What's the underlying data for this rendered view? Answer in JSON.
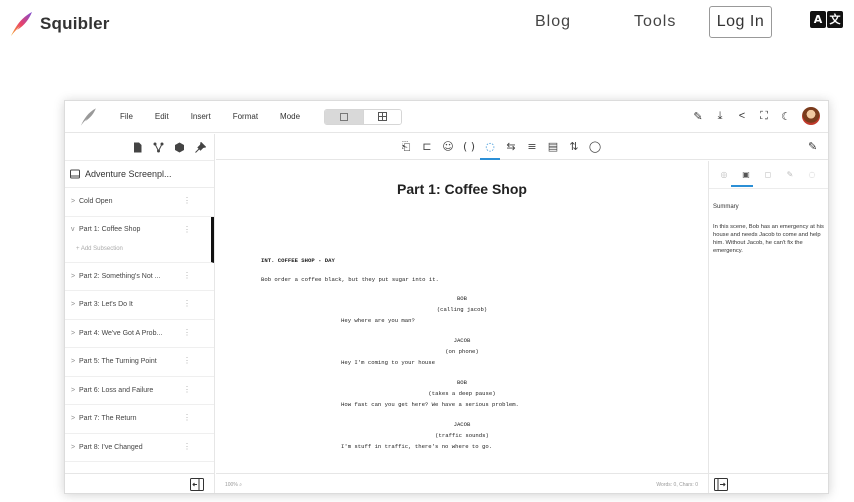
{
  "site": {
    "brand": "Squibler",
    "nav": {
      "blog": "Blog",
      "tools": "Tools",
      "login": "Log In"
    },
    "language_glyphs": [
      "A",
      "文"
    ]
  },
  "app": {
    "menu": [
      "File",
      "Edit",
      "Insert",
      "Format",
      "Mode"
    ],
    "document_title": "Adventure Screenpl...",
    "chapters": [
      {
        "label": "Cold Open",
        "chevron": ">"
      },
      {
        "label": "Part 1: Coffee Shop",
        "chevron": "v",
        "active": true,
        "sub": "+ Add Subsection"
      },
      {
        "label": "Part 2: Something's Not ...",
        "chevron": ">"
      },
      {
        "label": "Part 3: Let's Do It",
        "chevron": ">"
      },
      {
        "label": "Part 4: We've Got A Prob...",
        "chevron": ">"
      },
      {
        "label": "Part 5: The Turning Point",
        "chevron": ">"
      },
      {
        "label": "Part 6: Loss and Failure",
        "chevron": ">"
      },
      {
        "label": "Part 7: The Return",
        "chevron": ">"
      },
      {
        "label": "Part 8: I've Changed",
        "chevron": ">"
      }
    ],
    "scene_title": "Part 1: Coffee Shop",
    "script": {
      "slugline": "INT. COFFEE SHOP - DAY",
      "action": "Bob order a coffee black, but they put sugar into it.",
      "block1_character": "BOB",
      "block1_paren": "(calling jacob)",
      "block1_dialogue": "Hey where are you man?",
      "block2_character": "JACOB",
      "block2_paren": "(on phone)",
      "block2_dialogue": "Hey I'm coming to your house",
      "block3_character": "BOB",
      "block3_paren": "(takes a deep pause)",
      "block3_dialogue": "How fast can you get here? We have a serious problem.",
      "block4_character": "JACOB",
      "block4_paren": "(traffic sounds)",
      "block4_dialogue": "I'm stuff in traffic, there's no where to go."
    },
    "status": {
      "zoom": "100%",
      "counts": "Words: 0, Chars: 0"
    },
    "right_panel": {
      "summary_label": "Summary",
      "summary_text": "In this scene, Bob has an emergency at his house and needs Jacob to come and help him. Without Jacob, he can't fix the emergency."
    },
    "accent_color": "#2b8fd6"
  }
}
